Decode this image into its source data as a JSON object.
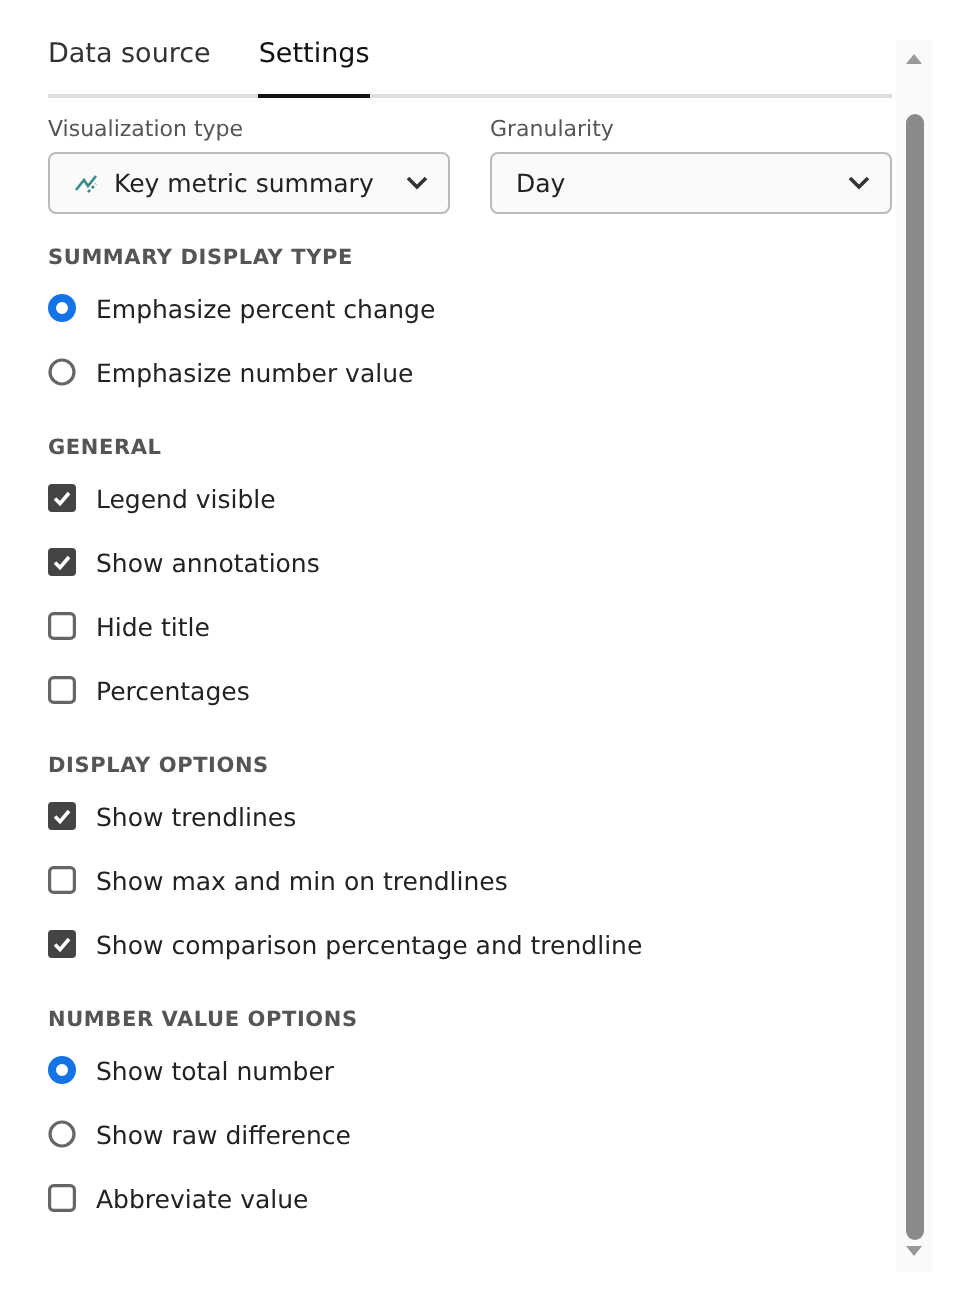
{
  "tabs": [
    {
      "label": "Data source",
      "selected": false
    },
    {
      "label": "Settings",
      "selected": true
    }
  ],
  "dropdowns": [
    {
      "label": "Visualization type",
      "value": "Key metric summary",
      "kind": "icon"
    },
    {
      "label": "Granularity",
      "value": "Day",
      "kind": "plain"
    }
  ],
  "sections": [
    {
      "title": "SUMMARY DISPLAY TYPE",
      "options": [
        {
          "kind": "radio",
          "label": "Emphasize percent change",
          "selected": true
        },
        {
          "kind": "radio",
          "label": "Emphasize number value",
          "selected": false
        }
      ]
    },
    {
      "title": "GENERAL",
      "options": [
        {
          "kind": "checkbox",
          "label": "Legend visible",
          "checked": true
        },
        {
          "kind": "checkbox",
          "label": "Show annotations",
          "checked": true
        },
        {
          "kind": "checkbox",
          "label": "Hide title",
          "checked": false
        },
        {
          "kind": "checkbox",
          "label": "Percentages",
          "checked": false
        }
      ]
    },
    {
      "title": "DISPLAY OPTIONS",
      "options": [
        {
          "kind": "checkbox",
          "label": "Show trendlines",
          "checked": true
        },
        {
          "kind": "checkbox",
          "label": "Show max and min on trendlines",
          "checked": false
        },
        {
          "kind": "checkbox",
          "label": "Show comparison percentage and trendline",
          "checked": true
        }
      ]
    },
    {
      "title": "NUMBER VALUE OPTIONS",
      "options": [
        {
          "kind": "radio",
          "label": "Show total number",
          "selected": true
        },
        {
          "kind": "radio",
          "label": "Show raw difference",
          "selected": false
        },
        {
          "kind": "checkbox",
          "label": "Abbreviate value",
          "checked": false
        }
      ]
    }
  ]
}
